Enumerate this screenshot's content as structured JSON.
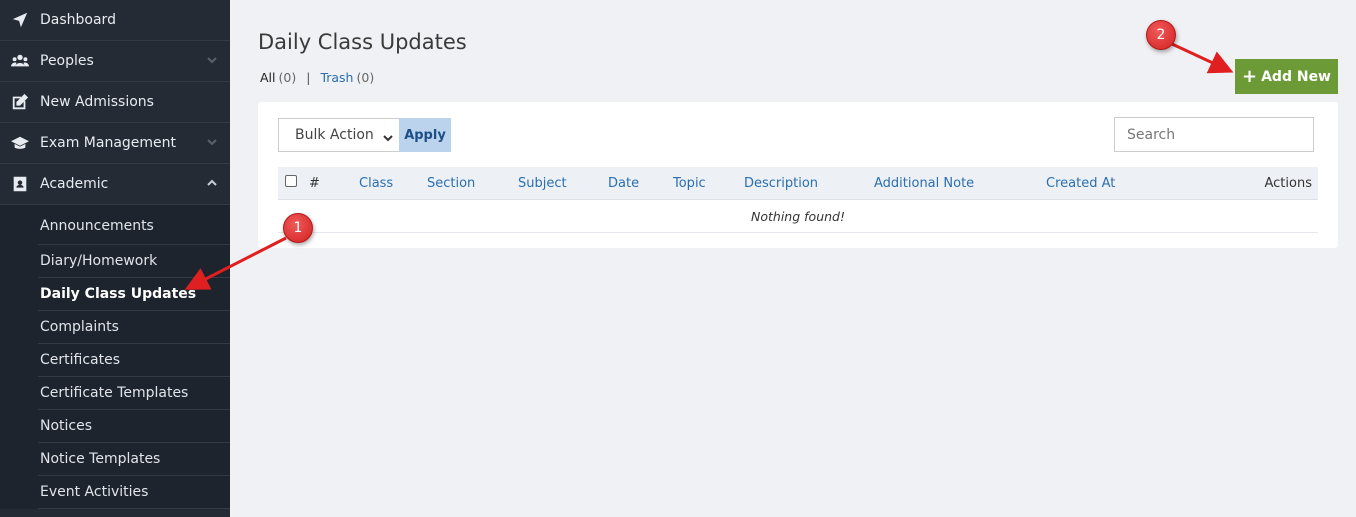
{
  "sidebar": {
    "items": [
      {
        "label": "Dashboard",
        "icon": "navigation-arrow-icon"
      },
      {
        "label": "Peoples",
        "icon": "users-icon"
      },
      {
        "label": "New Admissions",
        "icon": "edit-icon"
      },
      {
        "label": "Exam Management",
        "icon": "graduation-cap-icon"
      },
      {
        "label": "Academic",
        "icon": "address-card-icon"
      }
    ],
    "sub_items": [
      {
        "label": "Announcements"
      },
      {
        "label": "Diary/Homework"
      },
      {
        "label": "Daily Class Updates"
      },
      {
        "label": "Complaints"
      },
      {
        "label": "Certificates"
      },
      {
        "label": "Certificate Templates"
      },
      {
        "label": "Notices"
      },
      {
        "label": "Notice Templates"
      },
      {
        "label": "Event Activities"
      }
    ]
  },
  "main": {
    "title": "Daily Class Updates",
    "filters": {
      "all_label": "All",
      "all_count": "(0)",
      "separator": "|",
      "trash_label": "Trash",
      "trash_count": "(0)"
    },
    "add_button": {
      "plus": "+",
      "label": "Add New"
    },
    "bulk_action": {
      "selected": "Bulk Action"
    },
    "apply_label": "Apply",
    "search": {
      "placeholder": "Search",
      "value": ""
    },
    "table": {
      "columns": [
        "#",
        "Class",
        "Section",
        "Subject",
        "Date",
        "Topic",
        "Description",
        "Additional Note",
        "Created At",
        "Actions"
      ],
      "empty_message": "Nothing found!"
    }
  },
  "annotations": {
    "badge_1": "1",
    "badge_2": "2"
  },
  "colors": {
    "sidebar_bg": "#242b35",
    "accent_blue": "#2a6fb0",
    "add_button": "#6c9a37",
    "apply_button": "#bcd3ee",
    "annotation_red": "#e02020"
  }
}
